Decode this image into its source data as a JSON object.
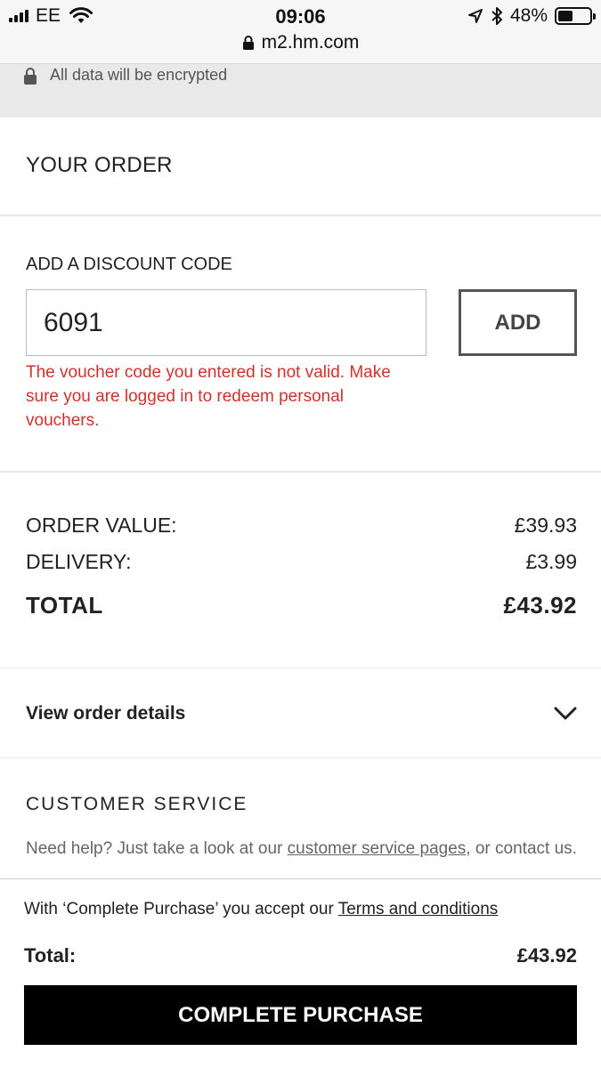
{
  "status_bar": {
    "carrier": "EE",
    "time": "09:06",
    "battery_percent": "48%",
    "battery_level": 0.48,
    "url": "m2.hm.com"
  },
  "secure_banner": {
    "text": "All data will be encrypted"
  },
  "order": {
    "title": "YOUR ORDER"
  },
  "discount": {
    "title": "ADD A DISCOUNT CODE",
    "code_value": "6091",
    "add_label": "ADD",
    "error": "The voucher code you entered is not valid. Make sure you are logged in to redeem personal vouchers."
  },
  "summary": {
    "order_value_label": "ORDER VALUE:",
    "order_value": "£39.93",
    "delivery_label": "DELIVERY:",
    "delivery": "£3.99",
    "total_label": "TOTAL",
    "total": "£43.92"
  },
  "view_details": {
    "label": "View order details"
  },
  "customer_service": {
    "title": "CUSTOMER SERVICE",
    "text_before": "Need help? Just take a look at our ",
    "link": "customer service pages",
    "text_after": ", or contact us."
  },
  "footer": {
    "terms_prefix": "With ‘Complete Purchase’ you accept our ",
    "terms_link": "Terms and conditions",
    "total_label": "Total:",
    "total": "£43.92",
    "button": "COMPLETE PURCHASE"
  },
  "icons": {
    "signal": "signal-icon",
    "wifi": "wifi-icon",
    "location": "location-arrow-icon",
    "bluetooth": "bluetooth-icon",
    "battery": "battery-icon",
    "lock": "lock-icon",
    "chevron": "chevron-down-icon"
  },
  "colors": {
    "error": "#d0312d",
    "primary_button": "#000000"
  }
}
